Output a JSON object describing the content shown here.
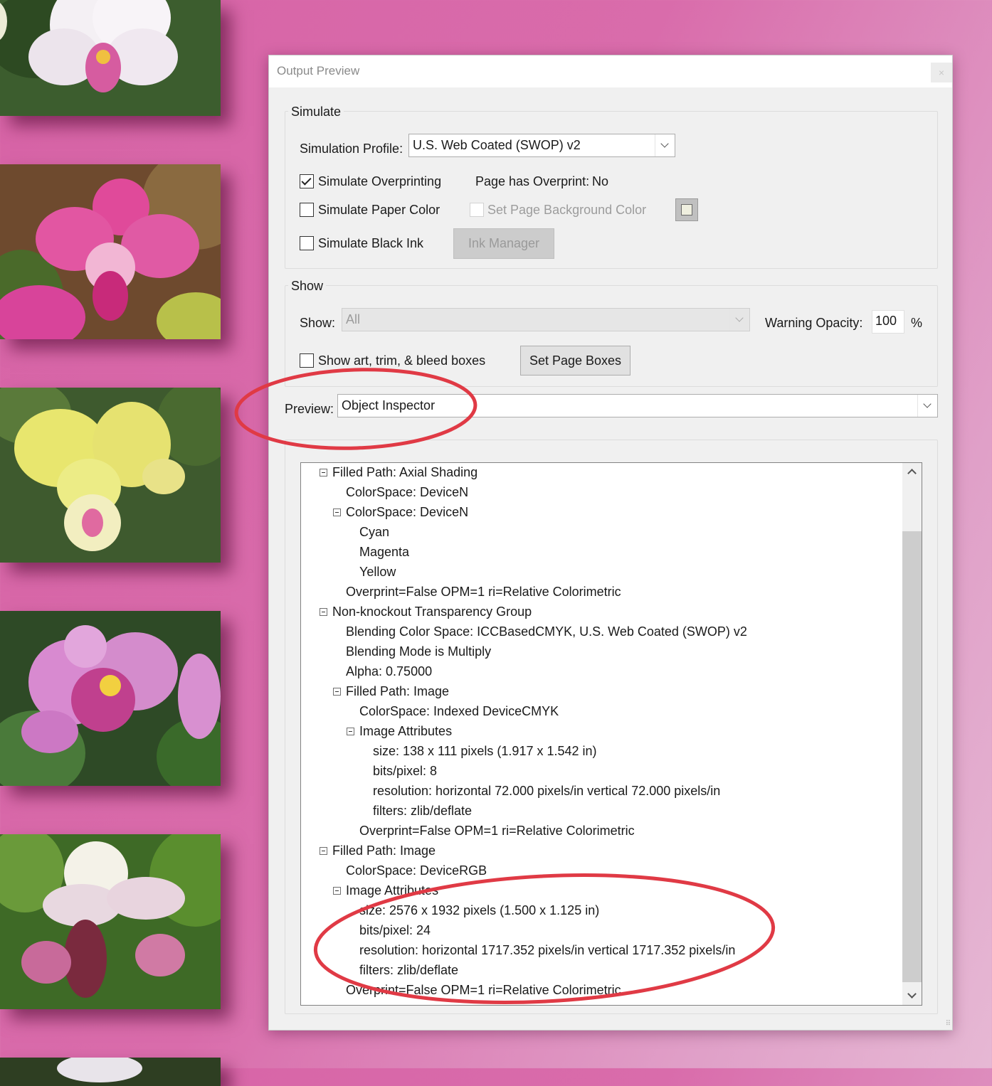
{
  "dialog": {
    "title": "Output Preview",
    "close_glyph": "×",
    "simulate": {
      "legend": "Simulate",
      "profile_label": "Simulation Profile:",
      "profile_value": "U.S. Web Coated (SWOP) v2",
      "simulate_overprinting": {
        "label": "Simulate Overprinting",
        "checked": true
      },
      "page_overprint_label": "Page has Overprint:",
      "page_overprint_value": "No",
      "simulate_paper_color": {
        "label": "Simulate Paper Color",
        "checked": false
      },
      "set_page_background": {
        "label": "Set Page Background Color",
        "checked": false,
        "enabled": false
      },
      "background_swatch_color": "#efefdf",
      "simulate_black_ink": {
        "label": "Simulate Black Ink",
        "checked": false
      },
      "ink_manager_label": "Ink Manager"
    },
    "show": {
      "legend": "Show",
      "show_label": "Show:",
      "show_value": "All",
      "warning_opacity_label": "Warning Opacity:",
      "warning_opacity_value": "100",
      "percent_label": "%",
      "show_boxes": {
        "label": "Show art, trim, & bleed boxes",
        "checked": false
      },
      "set_page_boxes_label": "Set Page Boxes"
    },
    "preview": {
      "label": "Preview:",
      "value": "Object Inspector"
    },
    "tree": [
      {
        "text": "Filled Path: Axial Shading",
        "expandable": true
      },
      {
        "text": "ColorSpace: DeviceN",
        "expandable": false
      },
      {
        "text": "ColorSpace: DeviceN",
        "expandable": true
      },
      {
        "text": "Cyan",
        "expandable": false
      },
      {
        "text": "Magenta",
        "expandable": false
      },
      {
        "text": "Yellow",
        "expandable": false
      },
      {
        "text": "Overprint=False OPM=1 ri=Relative Colorimetric",
        "expandable": false
      },
      {
        "text": "Non-knockout Transparency Group",
        "expandable": true
      },
      {
        "text": "Blending Color Space: ICCBasedCMYK, U.S. Web Coated (SWOP) v2",
        "expandable": false
      },
      {
        "text": "Blending Mode is Multiply",
        "expandable": false
      },
      {
        "text": "Alpha: 0.75000",
        "expandable": false
      },
      {
        "text": "Filled Path: Image",
        "expandable": true
      },
      {
        "text": "ColorSpace: Indexed DeviceCMYK",
        "expandable": false
      },
      {
        "text": "Image Attributes",
        "expandable": true
      },
      {
        "text": "size: 138 x 111 pixels (1.917 x 1.542 in)",
        "expandable": false
      },
      {
        "text": "bits/pixel: 8",
        "expandable": false
      },
      {
        "text": "resolution: horizontal 72.000 pixels/in vertical 72.000 pixels/in",
        "expandable": false
      },
      {
        "text": "filters: zlib/deflate",
        "expandable": false
      },
      {
        "text": "Overprint=False OPM=1 ri=Relative Colorimetric",
        "expandable": false
      },
      {
        "text": "Filled Path: Image",
        "expandable": true
      },
      {
        "text": "ColorSpace: DeviceRGB",
        "expandable": false
      },
      {
        "text": "Image Attributes",
        "expandable": true
      },
      {
        "text": "size: 2576 x 1932 pixels (1.500 x 1.125 in)",
        "expandable": false
      },
      {
        "text": "bits/pixel: 24",
        "expandable": false
      },
      {
        "text": "resolution: horizontal 1717.352 pixels/in vertical 1717.352 pixels/in",
        "expandable": false
      },
      {
        "text": "filters: zlib/deflate",
        "expandable": false
      },
      {
        "text": "Overprint=False OPM=1 ri=Relative Colorimetric",
        "expandable": false
      }
    ]
  },
  "annotation_color": "#e03a45",
  "photos": [
    {
      "subject": "white and pink phalaenopsis orchid"
    },
    {
      "subject": "magenta phalaenopsis orchid"
    },
    {
      "subject": "yellow cattleya orchid"
    },
    {
      "subject": "lavender cattleya orchid"
    },
    {
      "subject": "white striped paphiopedilum orchid"
    },
    {
      "subject": "white orchid (partially visible)"
    }
  ]
}
